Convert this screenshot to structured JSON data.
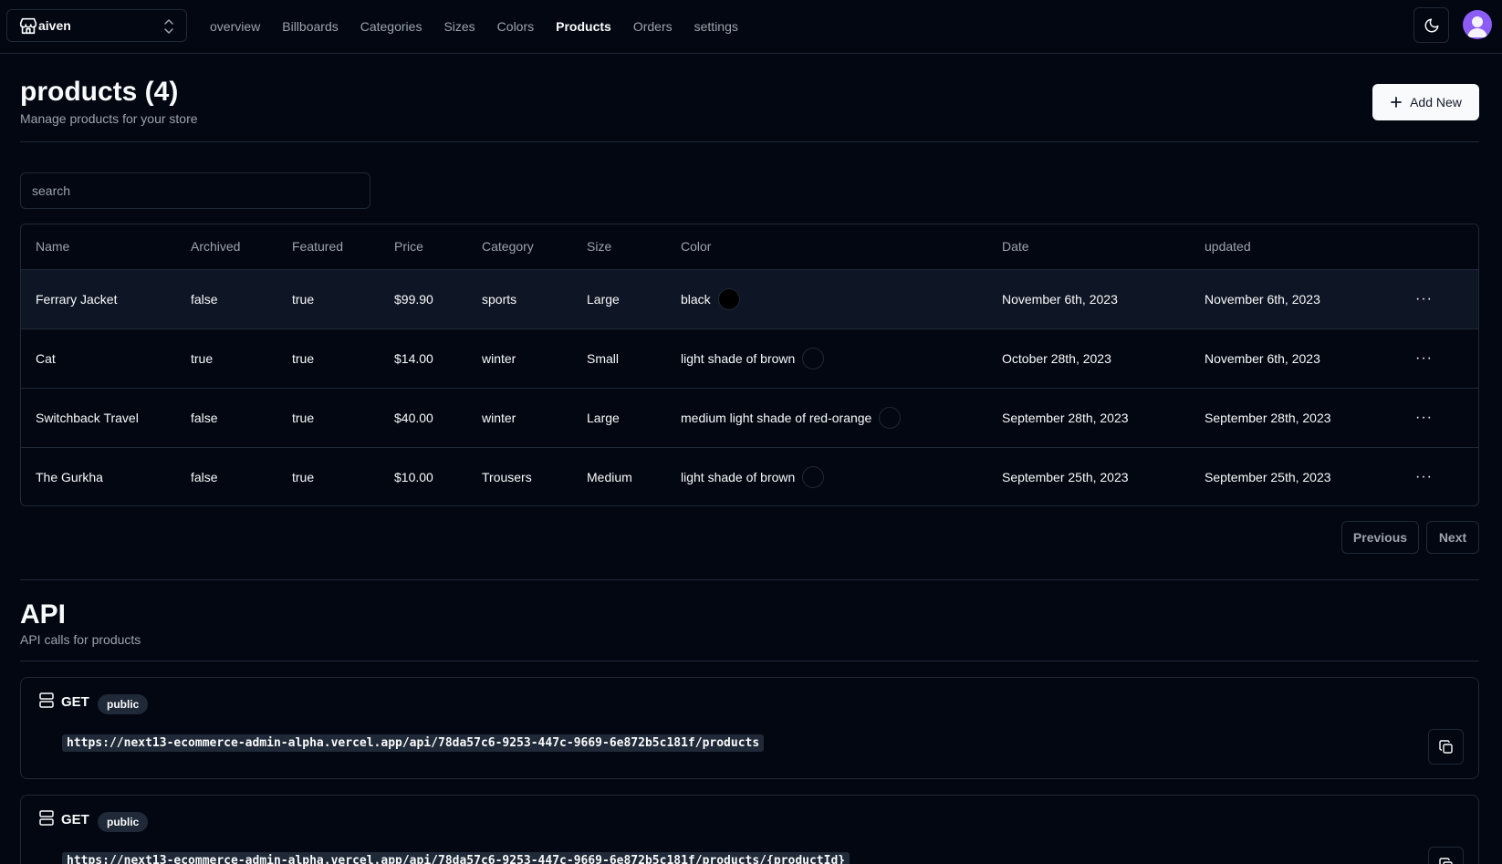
{
  "topbar": {
    "store_name": "aiven",
    "nav": [
      {
        "label": "overview",
        "active": false
      },
      {
        "label": "Billboards",
        "active": false
      },
      {
        "label": "Categories",
        "active": false
      },
      {
        "label": "Sizes",
        "active": false
      },
      {
        "label": "Colors",
        "active": false
      },
      {
        "label": "Products",
        "active": true
      },
      {
        "label": "Orders",
        "active": false
      },
      {
        "label": "settings",
        "active": false
      }
    ],
    "avatar_color": "#8b5cf6"
  },
  "header": {
    "title": "products (4)",
    "subtitle": "Manage products for your store",
    "add_label": "Add New"
  },
  "search": {
    "placeholder": "search"
  },
  "table": {
    "columns": [
      "Name",
      "Archived",
      "Featured",
      "Price",
      "Category",
      "Size",
      "Color",
      "Date",
      "updated"
    ],
    "rows": [
      {
        "name": "Ferrary Jacket",
        "archived": "false",
        "featured": "true",
        "price": "$99.90",
        "category": "sports",
        "size": "Large",
        "color": "black",
        "swatch": "#000000",
        "date": "November 6th, 2023",
        "updated": "November 6th, 2023"
      },
      {
        "name": "Cat",
        "archived": "true",
        "featured": "true",
        "price": "$14.00",
        "category": "winter",
        "size": "Small",
        "color": "light shade of brown",
        "swatch": "#030712",
        "date": "October 28th, 2023",
        "updated": "November 6th, 2023"
      },
      {
        "name": "Switchback Travel",
        "archived": "false",
        "featured": "true",
        "price": "$40.00",
        "category": "winter",
        "size": "Large",
        "color": "medium light shade of red-orange",
        "swatch": "#030712",
        "date": "September 28th, 2023",
        "updated": "September 28th, 2023"
      },
      {
        "name": "The Gurkha",
        "archived": "false",
        "featured": "true",
        "price": "$10.00",
        "category": "Trousers",
        "size": "Medium",
        "color": "light shade of brown",
        "swatch": "#030712",
        "date": "September 25th, 2023",
        "updated": "September 25th, 2023"
      }
    ],
    "row_menu_label": "···"
  },
  "pagination": {
    "previous": "Previous",
    "next": "Next"
  },
  "api": {
    "title": "API",
    "subtitle": "API calls for products",
    "calls": [
      {
        "method": "GET",
        "badge": "public",
        "url": "https://next13-ecommerce-admin-alpha.vercel.app/api/78da57c6-9253-447c-9669-6e872b5c181f/products"
      },
      {
        "method": "GET",
        "badge": "public",
        "url": "https://next13-ecommerce-admin-alpha.vercel.app/api/78da57c6-9253-447c-9669-6e872b5c181f/products/{productId}"
      }
    ]
  }
}
